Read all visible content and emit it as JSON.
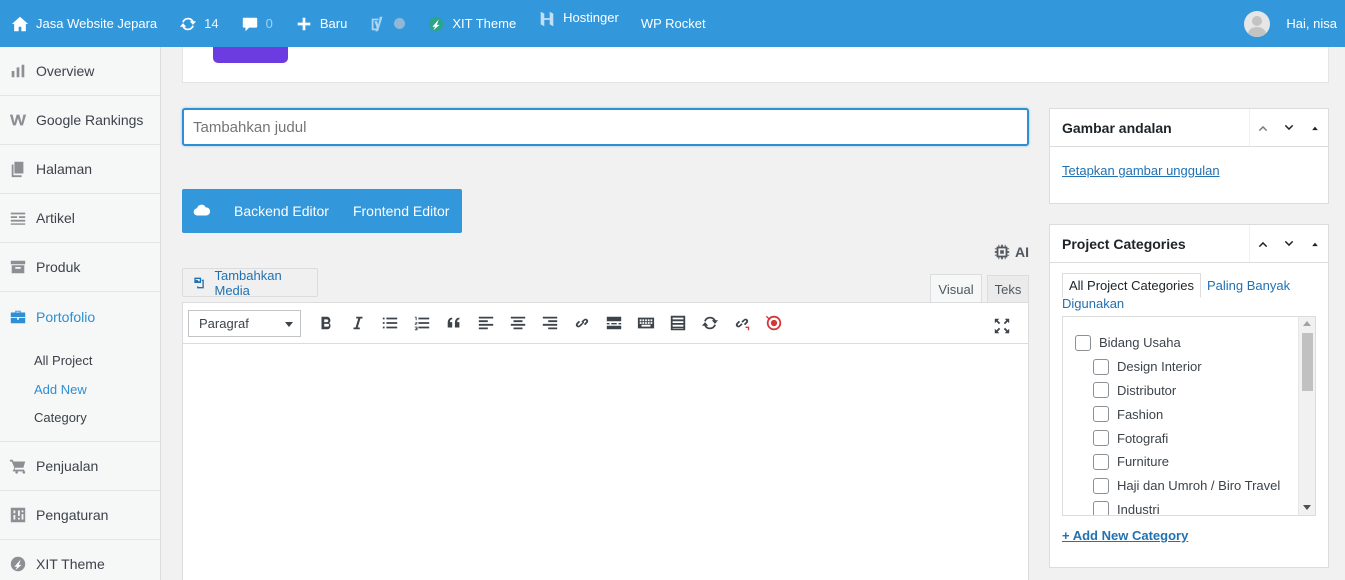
{
  "adminbar": {
    "site_name": "Jasa Website Jepara",
    "updates_count": "14",
    "comments_count": "0",
    "new_label": "Baru",
    "xit_theme": "XIT Theme",
    "hostinger": "Hostinger",
    "wp_rocket": "WP Rocket",
    "greeting": "Hai, nisa",
    "bar_color": "#3397db"
  },
  "sidebar": {
    "items": [
      {
        "label": "Overview",
        "icon": "chart-bar-icon"
      },
      {
        "label": "Google Rankings",
        "icon": "w-logo-icon"
      },
      {
        "label": "Halaman",
        "icon": "pages-icon"
      },
      {
        "label": "Artikel",
        "icon": "posts-icon"
      },
      {
        "label": "Produk",
        "icon": "archive-icon"
      },
      {
        "label": "Portofolio",
        "icon": "briefcase-icon"
      },
      {
        "label": "Penjualan",
        "icon": "cart-icon"
      },
      {
        "label": "Pengaturan",
        "icon": "settings-icon"
      },
      {
        "label": "XIT Theme",
        "icon": "xit-logo-icon"
      }
    ],
    "submenu": [
      "All Project",
      "Add New",
      "Category"
    ],
    "accent": "#2e8fd4"
  },
  "title": {
    "placeholder": "Tambahkan judul"
  },
  "editor_switch": {
    "backend": "Backend Editor",
    "frontend": "Frontend Editor"
  },
  "ai_label": "AI",
  "media_button": "Tambahkan Media",
  "tabs": {
    "visual": "Visual",
    "text": "Teks"
  },
  "toolbar": {
    "format": "Paragraf"
  },
  "featured_image": {
    "title": "Gambar andalan",
    "link": "Tetapkan gambar unggulan"
  },
  "categories": {
    "title": "Project Categories",
    "tab_all": "All Project Categories",
    "tab_popular": "Paling Banyak Digunakan",
    "parent": "Bidang Usaha",
    "children": [
      "Design Interior",
      "Distributor",
      "Fashion",
      "Fotografi",
      "Furniture",
      "Haji dan Umroh / Biro Travel",
      "Industri"
    ],
    "add_new": "+ Add New Category"
  }
}
